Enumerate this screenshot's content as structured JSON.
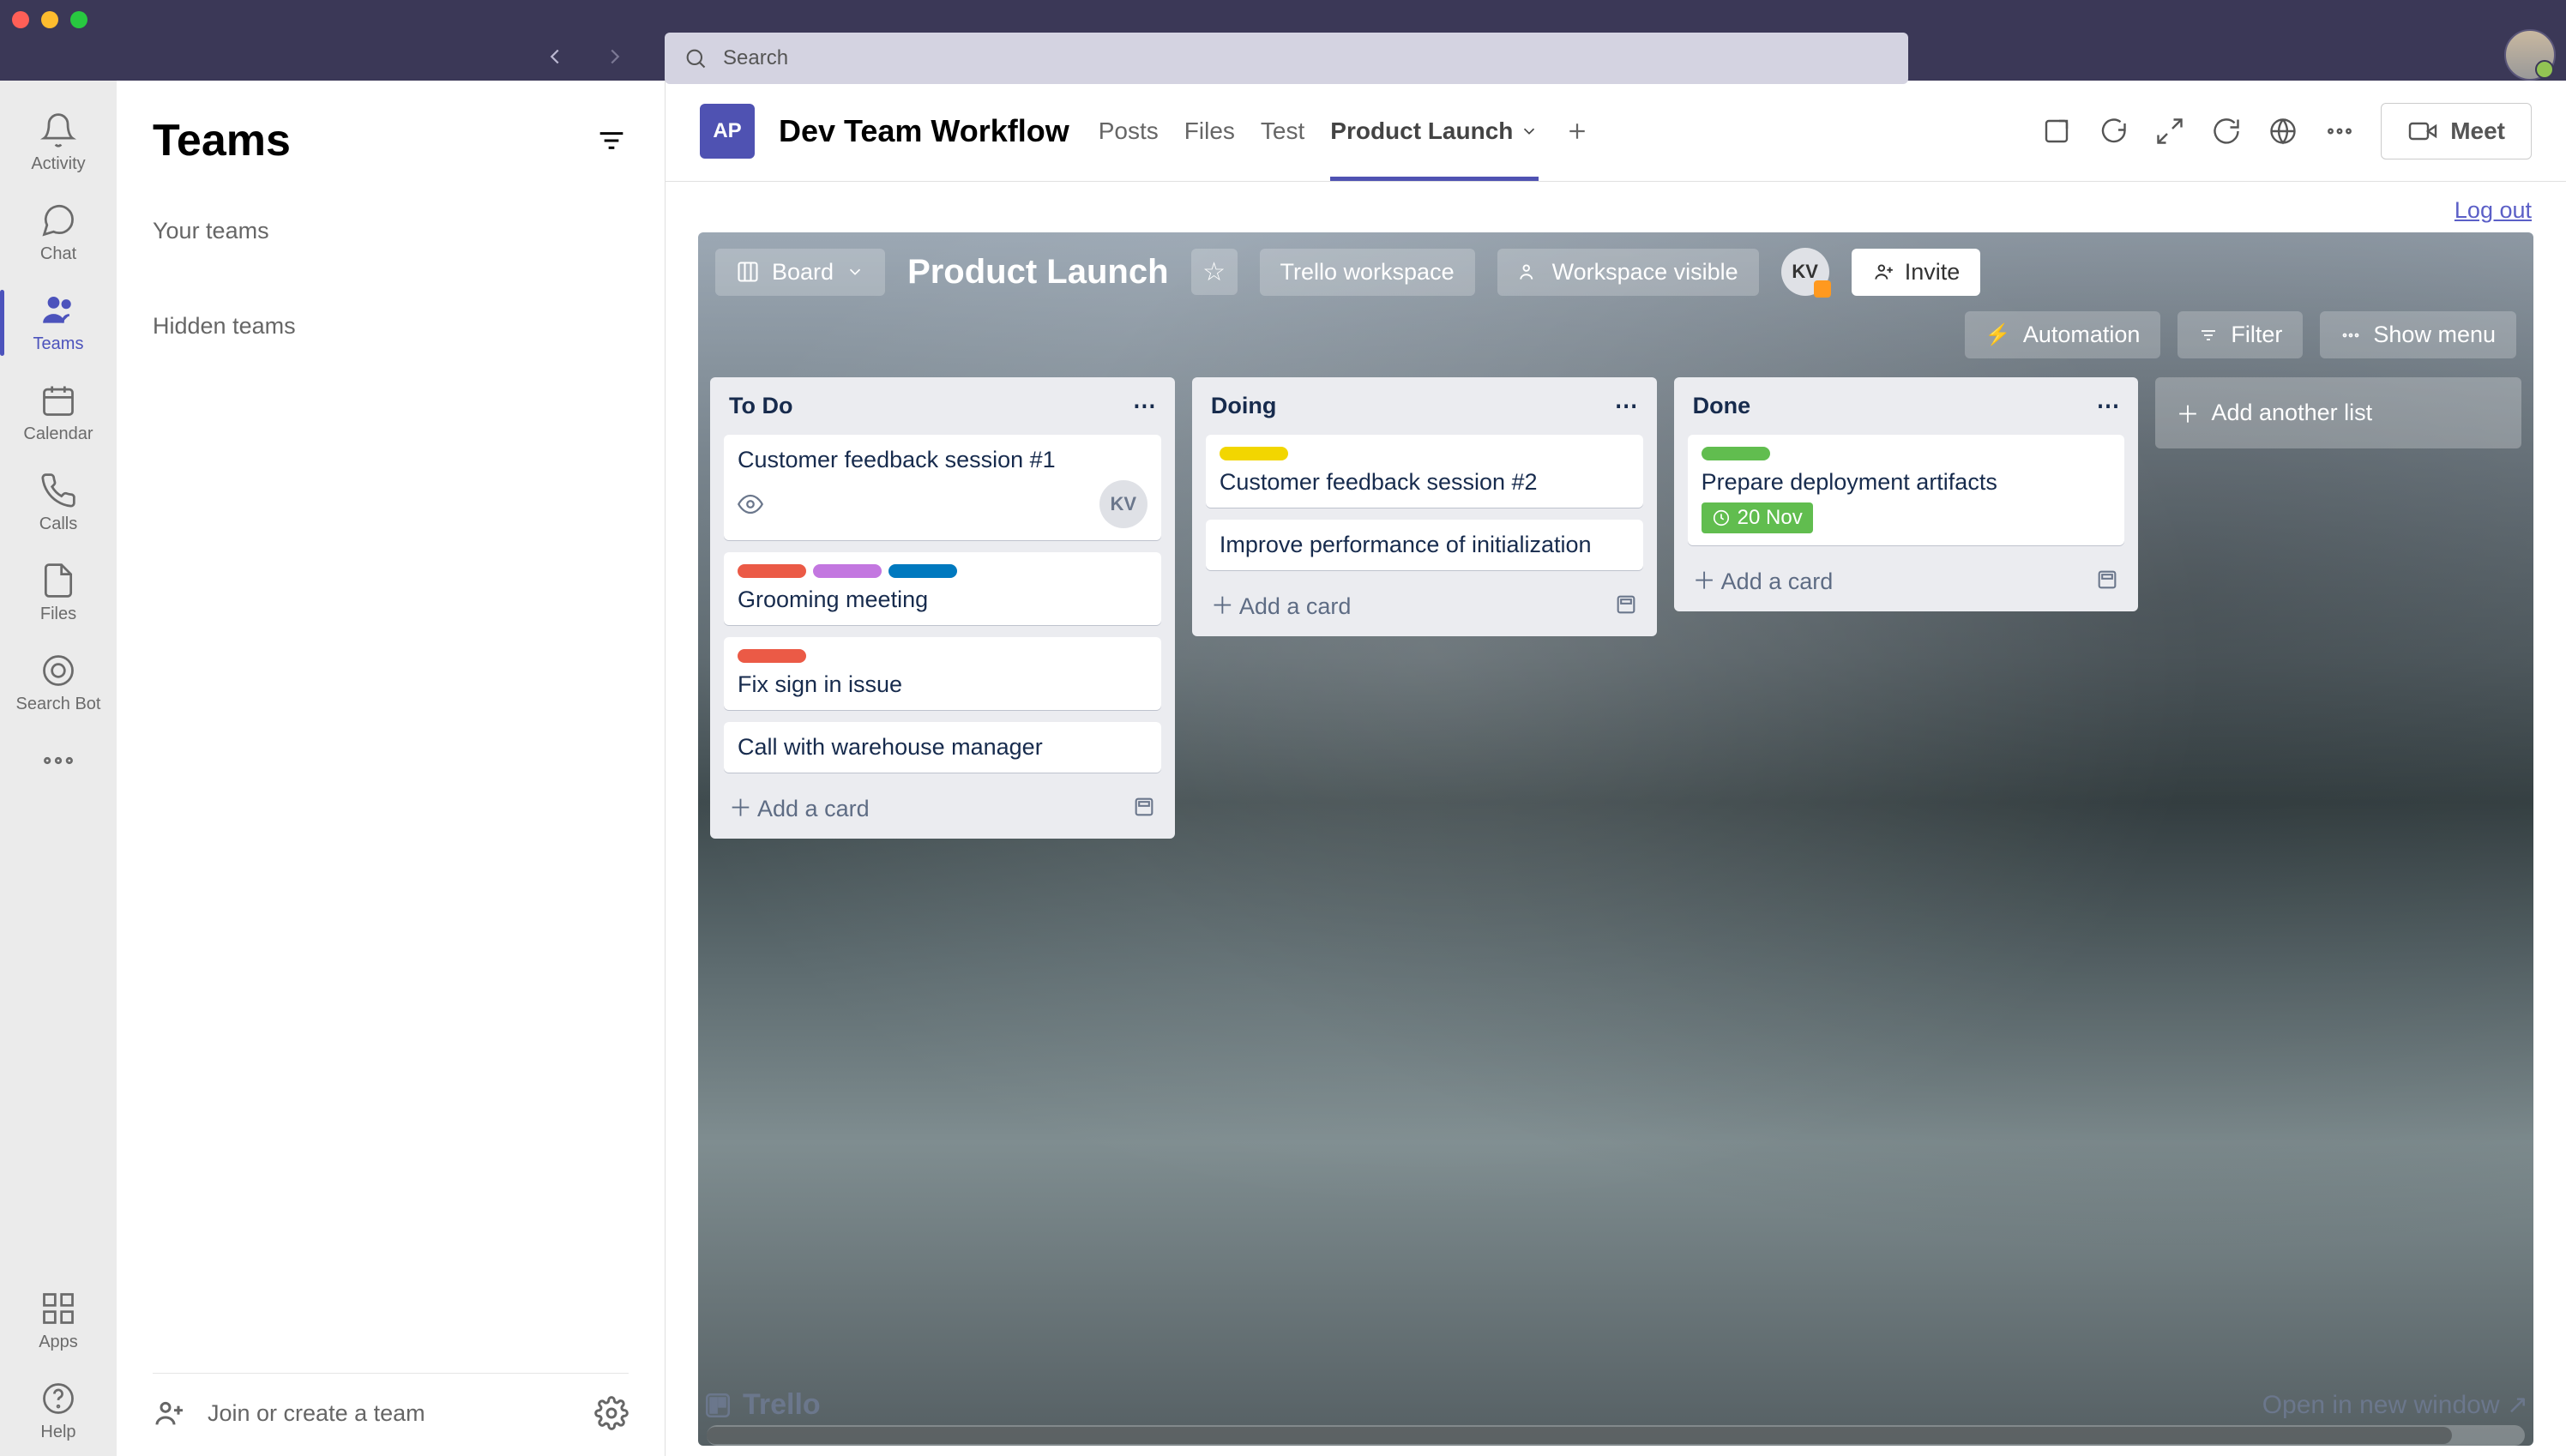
{
  "search": {
    "placeholder": "Search"
  },
  "rail": {
    "items": [
      {
        "label": "Activity"
      },
      {
        "label": "Chat"
      },
      {
        "label": "Teams"
      },
      {
        "label": "Calendar"
      },
      {
        "label": "Calls"
      },
      {
        "label": "Files"
      },
      {
        "label": "Search Bot"
      }
    ],
    "apps": "Apps",
    "help": "Help"
  },
  "teamspanel": {
    "title": "Teams",
    "your": "Your teams",
    "hidden": "Hidden teams",
    "join": "Join or create a team"
  },
  "chead": {
    "badge": "AP",
    "team": "Dev Team Workflow",
    "tabs": [
      "Posts",
      "Files",
      "Test",
      "Product Launch"
    ],
    "meet": "Meet"
  },
  "logout": "Log out",
  "board": {
    "boardBtn": "Board",
    "title": "Product Launch",
    "workspace": "Trello workspace",
    "visibility": "Workspace visible",
    "invite": "Invite",
    "kv": "KV",
    "automation": "Automation",
    "filter": "Filter",
    "showmenu": "Show menu",
    "addlist": "Add another list",
    "addcard": "Add a card",
    "lists": [
      {
        "name": "To Do",
        "cards": [
          {
            "title": "Customer feedback session #1",
            "eye": true,
            "member": "KV"
          },
          {
            "title": "Grooming meeting",
            "labels": [
              "red",
              "pur",
              "blu"
            ]
          },
          {
            "title": "Fix sign in issue",
            "labels": [
              "red"
            ]
          },
          {
            "title": "Call with warehouse manager"
          }
        ]
      },
      {
        "name": "Doing",
        "cards": [
          {
            "title": "Customer feedback session #2",
            "labels": [
              "yel"
            ]
          },
          {
            "title": "Improve performance of initialization"
          }
        ]
      },
      {
        "name": "Done",
        "cards": [
          {
            "title": "Prepare deployment artifacts",
            "labels": [
              "grn"
            ],
            "due": "20 Nov"
          }
        ]
      }
    ]
  },
  "footer": {
    "trello": "Trello",
    "open": "Open in new window ↗"
  }
}
